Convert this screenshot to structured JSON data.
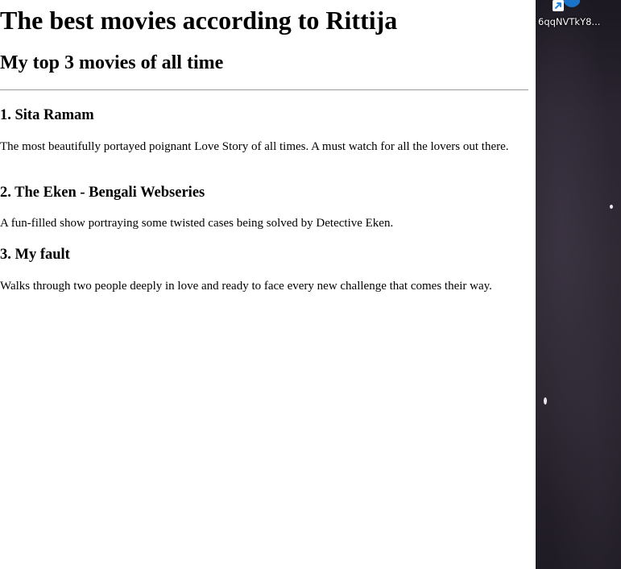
{
  "page": {
    "title": "The best movies according to Rittija",
    "subtitle": "My top 3 movies of all time",
    "movies": [
      {
        "title": "1. Sita Ramam",
        "description": "The most beautifully portayed poignant Love Story of all times. A must watch for all the lovers out there."
      },
      {
        "title": "2. The Eken - Bengali Webseries",
        "description": "A fun-filled show portraying some twisted cases being solved by Detective Eken."
      },
      {
        "title": "3. My fault",
        "description": "Walks through two people deeply in love and ready to face every new challenge that comes their way."
      }
    ]
  },
  "desktop": {
    "shortcut": {
      "label": "6qqNVTkY8...",
      "icon": "edge-browser-shortcut-icon"
    }
  },
  "colors": {
    "divider": "#9a9a9a",
    "desktop_background": "#2a2531",
    "shortcut_arrow": "#1e88e5",
    "icon_green": "#3cb54a"
  }
}
